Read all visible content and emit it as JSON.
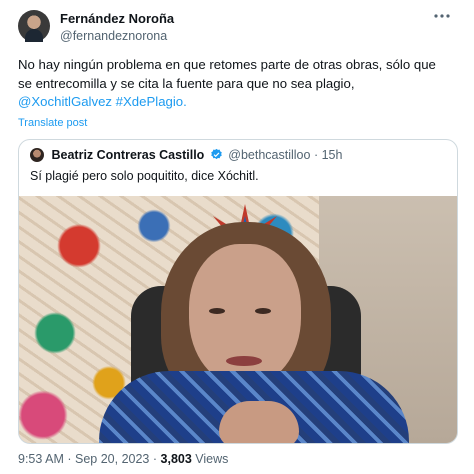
{
  "author": {
    "name": "Fernández Noroña",
    "handle": "@fernandeznorona"
  },
  "post": {
    "line1": "No hay ningún problema en que retomes parte de otras obras, sólo que",
    "line2": "se entrecomilla y se cita la fuente para que no sea plagio,",
    "hashtags": "@XochitlGalvez #XdePlagio.",
    "translate_label": "Translate post"
  },
  "quote": {
    "name": "Beatriz Contreras Castillo",
    "handle": "@bethcastilloo",
    "separator": "·",
    "time": "15h",
    "text": "Sí plagié pero solo poquitito, dice Xóchitl."
  },
  "meta": {
    "time": "9:53 AM",
    "sep1": "·",
    "date": "Sep 20, 2023",
    "sep2": "·",
    "views_count": "3,803",
    "views_label": "Views"
  },
  "icons": {
    "more": "more-horizontal-icon",
    "verified": "verified-badge-icon"
  },
  "colors": {
    "link": "#1d9bf0",
    "secondary_text": "#536471",
    "border": "#cfd9de"
  }
}
